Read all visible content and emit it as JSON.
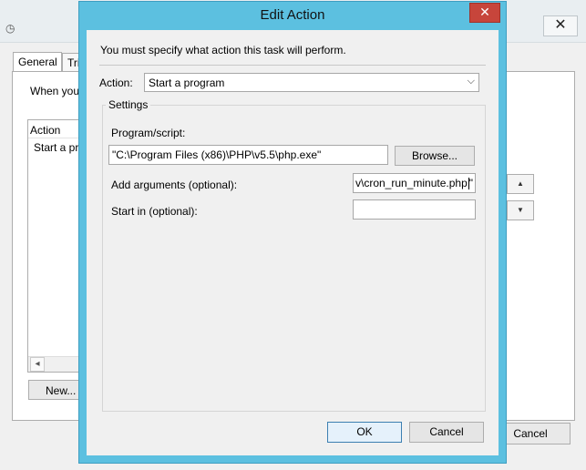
{
  "background_window": {
    "tabs": [
      {
        "label": "General"
      },
      {
        "label": "Tri"
      }
    ],
    "when_text": "When you",
    "list": {
      "header": "Action",
      "row": "Start a pr"
    },
    "new_label": "New...",
    "cancel_label": "Cancel",
    "close_glyph": "✕"
  },
  "dialog": {
    "title": "Edit Action",
    "close_glyph": "✕",
    "instruction": "You must specify what action this task will perform.",
    "action": {
      "label": "Action:",
      "value": "Start a program"
    },
    "settings": {
      "legend": "Settings",
      "program_label": "Program/script:",
      "program_value": "\"C:\\Program Files (x86)\\PHP\\v5.5\\php.exe\"",
      "browse_label": "Browse...",
      "args_label": "Add arguments (optional):",
      "args_value": "v\\cron_run_minute.php",
      "args_trailing": "\"",
      "startin_label": "Start in (optional):",
      "startin_value": ""
    },
    "ok_label": "OK",
    "cancel_label": "Cancel"
  },
  "colors": {
    "dialog_frame": "#5cc0e0",
    "close_button": "#c7453b",
    "client_bg": "#f0f0f0"
  },
  "icons": {
    "app": "clock-icon",
    "dropdown": "chevron-down-icon",
    "up": "arrow-up-icon",
    "down": "arrow-down-icon",
    "scroll_left": "arrow-left-icon"
  }
}
